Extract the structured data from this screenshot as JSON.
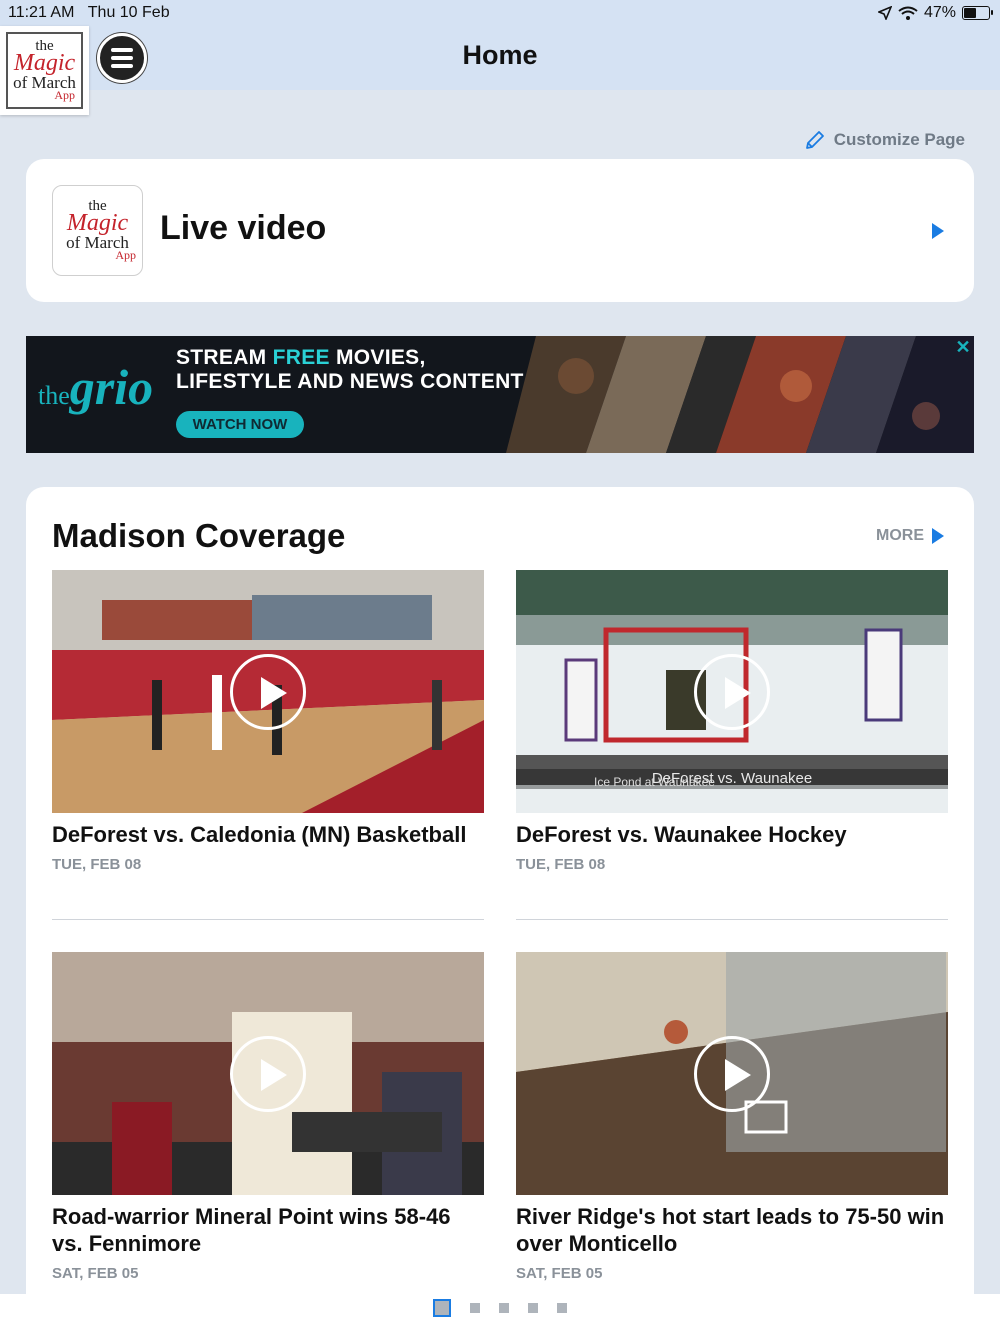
{
  "status_bar": {
    "time": "11:21 AM",
    "date": "Thu 10 Feb",
    "battery": "47%",
    "battery_level": 0.47
  },
  "nav": {
    "title": "Home",
    "logo": {
      "the": "the",
      "magic": "Magic",
      "march": "of March",
      "app": "App"
    }
  },
  "customize": {
    "label": "Customize Page"
  },
  "live_video": {
    "title": "Live video"
  },
  "ad": {
    "brand_small": "the",
    "brand_big": "grio",
    "line1_a": "STREAM ",
    "line1_free": "FREE",
    "line1_b": " MOVIES,",
    "line2": "LIFESTYLE AND NEWS CONTENT",
    "cta": "WATCH NOW",
    "close": "✕"
  },
  "coverage": {
    "title": "Madison Coverage",
    "more": "MORE",
    "items": [
      {
        "title": "DeForest vs. Caledonia (MN) Basketball",
        "date": "TUE, FEB 08"
      },
      {
        "title": "DeForest vs. Waunakee Hockey",
        "date": "TUE, FEB 08",
        "caption": "DeForest vs. Waunakee",
        "subcaption": "Ice Pond at Waunakee"
      },
      {
        "title": "Road-warrior Mineral Point wins 58-46 vs. Fennimore",
        "date": "SAT, FEB 05"
      },
      {
        "title": "River Ridge's hot start leads to 75-50 win over Monticello",
        "date": "SAT, FEB 05"
      }
    ]
  },
  "pager": {
    "count": 5,
    "active": 0
  },
  "colors": {
    "accent": "#1a7ce2",
    "nav_bg": "#d5e2f3",
    "page_bg": "#dfe6ef",
    "brand_teal": "#18b3bd"
  }
}
